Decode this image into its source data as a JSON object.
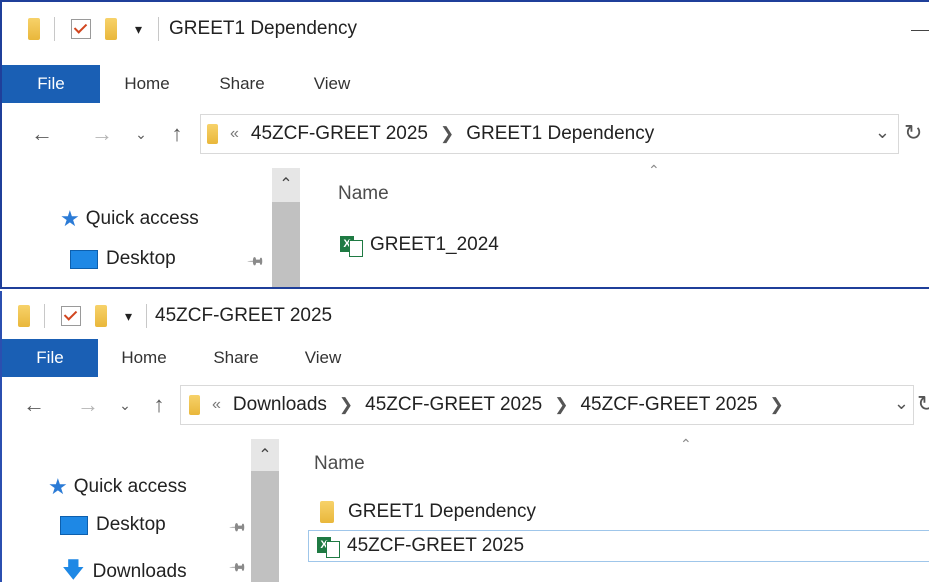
{
  "top_window": {
    "title": "GREET1 Dependency",
    "ribbon_tabs": [
      "File",
      "Home",
      "Share",
      "View"
    ],
    "address": {
      "overflow": "«",
      "crumbs": [
        "45ZCF-GREET 2025",
        "GREET1 Dependency"
      ]
    },
    "sidebar": [
      {
        "label": "Quick access",
        "icon": "star-icon"
      },
      {
        "label": "Desktop",
        "icon": "desktop-icon",
        "pinned": true
      }
    ],
    "column_header": "Name",
    "files": [
      {
        "name": "GREET1_2024",
        "icon": "excel-file-icon"
      }
    ]
  },
  "bottom_window": {
    "title": "45ZCF-GREET 2025",
    "ribbon_tabs": [
      "File",
      "Home",
      "Share",
      "View"
    ],
    "address": {
      "overflow": "«",
      "crumbs": [
        "Downloads",
        "45ZCF-GREET 2025",
        "45ZCF-GREET 2025"
      ]
    },
    "sidebar": [
      {
        "label": "Quick access",
        "icon": "star-icon"
      },
      {
        "label": "Desktop",
        "icon": "desktop-icon",
        "pinned": true
      },
      {
        "label": "Downloads",
        "icon": "download-arrow-icon",
        "pinned": true
      }
    ],
    "column_header": "Name",
    "files": [
      {
        "name": "GREET1 Dependency",
        "icon": "folder-icon"
      },
      {
        "name": "45ZCF-GREET 2025",
        "icon": "excel-file-icon",
        "selected": true
      }
    ]
  },
  "colors": {
    "file_tab": "#1a5fb4",
    "folder": "#e9b73b",
    "excel": "#1f7a43",
    "window_border": "#1f3f9a"
  }
}
